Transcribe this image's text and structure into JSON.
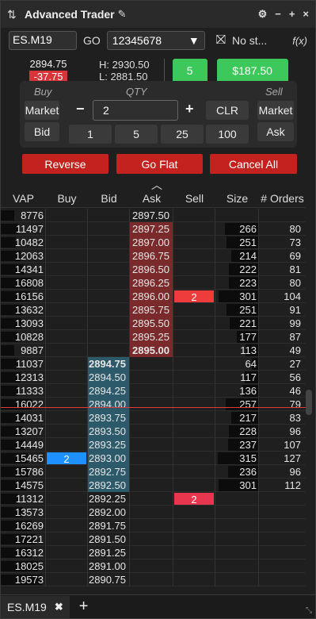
{
  "window": {
    "title": "Advanced Trader",
    "controls": [
      "⚙",
      "−",
      "+",
      "×"
    ]
  },
  "toolbar": {
    "symbol": "ES.M19",
    "go_label": "GO",
    "account": "12345678",
    "strategy": "No st...",
    "fx_label": "f(x)"
  },
  "quote": {
    "last": "2894.75",
    "change": "-37.75",
    "high": "H: 2930.50",
    "low": "L: 2881.50",
    "position": "5",
    "pnl": "$187.50"
  },
  "order_panel": {
    "buy_label": "Buy",
    "qty_label": "QTY",
    "sell_label": "Sell",
    "buy_market": "Market",
    "buy_bid": "Bid",
    "qty_value": "2",
    "minus": "−",
    "plus": "+",
    "clr": "CLR",
    "sell_market": "Market",
    "sell_ask": "Ask",
    "presets": [
      "1",
      "5",
      "25",
      "100"
    ]
  },
  "actions": {
    "reverse": "Reverse",
    "go_flat": "Go Flat",
    "cancel_all": "Cancel All"
  },
  "ladder": {
    "headers": [
      "VAP",
      "Buy",
      "Bid",
      "Ask",
      "Sell",
      "Size",
      "# Orders"
    ],
    "rows": [
      {
        "vap": "8776",
        "bid": "",
        "ask": "2897.50",
        "size": "",
        "orders": "",
        "type": "ask-plain",
        "vapw": 0.3
      },
      {
        "vap": "11497",
        "bid": "",
        "ask": "2897.25",
        "size": "266",
        "orders": "80",
        "type": "ask",
        "vapw": 0.4,
        "sizew": 0.8
      },
      {
        "vap": "10482",
        "bid": "",
        "ask": "2897.00",
        "size": "251",
        "orders": "73",
        "type": "ask",
        "vapw": 0.35,
        "sizew": 0.75
      },
      {
        "vap": "12063",
        "bid": "",
        "ask": "2896.75",
        "size": "214",
        "orders": "69",
        "type": "ask",
        "vapw": 0.45,
        "sizew": 0.65
      },
      {
        "vap": "14341",
        "bid": "",
        "ask": "2896.50",
        "size": "222",
        "orders": "81",
        "type": "ask",
        "vapw": 0.55,
        "sizew": 0.7
      },
      {
        "vap": "16808",
        "bid": "",
        "ask": "2896.25",
        "size": "223",
        "orders": "80",
        "type": "ask",
        "vapw": 0.7,
        "sizew": 0.7
      },
      {
        "vap": "16156",
        "bid": "",
        "ask": "2896.00",
        "size": "301",
        "orders": "104",
        "type": "ask",
        "vapw": 0.68,
        "sizew": 0.95,
        "sell_order": "2"
      },
      {
        "vap": "13632",
        "bid": "",
        "ask": "2895.75",
        "size": "251",
        "orders": "91",
        "type": "ask",
        "vapw": 0.5,
        "sizew": 0.75
      },
      {
        "vap": "13093",
        "bid": "",
        "ask": "2895.50",
        "size": "221",
        "orders": "99",
        "type": "ask",
        "vapw": 0.48,
        "sizew": 0.68
      },
      {
        "vap": "10828",
        "bid": "",
        "ask": "2895.25",
        "size": "177",
        "orders": "87",
        "type": "ask",
        "vapw": 0.38,
        "sizew": 0.5
      },
      {
        "vap": "9887",
        "bid": "",
        "ask": "2895.00",
        "size": "113",
        "orders": "49",
        "type": "ask-bold",
        "vapw": 0.3,
        "sizew": 0.3
      },
      {
        "vap": "11037",
        "bid": "2894.75",
        "ask": "",
        "size": "64",
        "orders": "27",
        "type": "bid-bold",
        "vapw": 0.4,
        "sizew": 0.15
      },
      {
        "vap": "12313",
        "bid": "2894.50",
        "ask": "",
        "size": "117",
        "orders": "56",
        "type": "bid",
        "vapw": 0.45,
        "sizew": 0.32
      },
      {
        "vap": "11333",
        "bid": "2894.25",
        "ask": "",
        "size": "136",
        "orders": "46",
        "type": "bid",
        "vapw": 0.4,
        "sizew": 0.38
      },
      {
        "vap": "16022",
        "bid": "2894.00",
        "ask": "",
        "size": "257",
        "orders": "79",
        "type": "bid",
        "vapw": 0.7,
        "sizew": 0.78
      },
      {
        "vap": "14031",
        "bid": "2893.75",
        "ask": "",
        "size": "217",
        "orders": "83",
        "type": "bid",
        "vapw": 0.55,
        "sizew": 0.65
      },
      {
        "vap": "13207",
        "bid": "2893.50",
        "ask": "",
        "size": "228",
        "orders": "96",
        "type": "bid",
        "vapw": 0.5,
        "sizew": 0.7
      },
      {
        "vap": "14449",
        "bid": "2893.25",
        "ask": "",
        "size": "237",
        "orders": "107",
        "type": "bid",
        "vapw": 0.57,
        "sizew": 0.72
      },
      {
        "vap": "15465",
        "bid": "2893.00",
        "ask": "",
        "size": "315",
        "orders": "127",
        "type": "bid",
        "vapw": 0.62,
        "sizew": 0.97,
        "buy_order": "2"
      },
      {
        "vap": "15786",
        "bid": "2892.75",
        "ask": "",
        "size": "236",
        "orders": "96",
        "type": "bid",
        "vapw": 0.64,
        "sizew": 0.72
      },
      {
        "vap": "14575",
        "bid": "2892.50",
        "ask": "",
        "size": "301",
        "orders": "112",
        "type": "bid",
        "vapw": 0.58,
        "sizew": 0.95
      },
      {
        "vap": "11312",
        "bid": "2892.25",
        "ask": "",
        "size": "",
        "orders": "",
        "type": "plain",
        "vapw": 0.4,
        "sell_order": "2",
        "sell_pink": true
      },
      {
        "vap": "13573",
        "bid": "2892.00",
        "ask": "",
        "size": "",
        "orders": "",
        "type": "plain",
        "vapw": 0.5
      },
      {
        "vap": "16269",
        "bid": "2891.75",
        "ask": "",
        "size": "",
        "orders": "",
        "type": "plain",
        "vapw": 0.7
      },
      {
        "vap": "17221",
        "bid": "2891.50",
        "ask": "",
        "size": "",
        "orders": "",
        "type": "plain",
        "vapw": 0.8
      },
      {
        "vap": "16312",
        "bid": "2891.25",
        "ask": "",
        "size": "",
        "orders": "",
        "type": "plain",
        "vapw": 0.7
      },
      {
        "vap": "18025",
        "bid": "2891.00",
        "ask": "",
        "size": "",
        "orders": "",
        "type": "plain",
        "vapw": 0.85
      },
      {
        "vap": "19573",
        "bid": "2890.75",
        "ask": "",
        "size": "",
        "orders": "",
        "type": "plain",
        "vapw": 0.95
      }
    ],
    "last_line_after_row": 13
  },
  "tabs": [
    {
      "label": "ES.M19"
    }
  ],
  "add_tab": "+",
  "colors": {
    "ask_cell": "#7a2a2a",
    "bid_cell": "#2c5a6a",
    "buy_green": "#3cc85a",
    "action_red": "#c4221e",
    "change_red": "#d8343a",
    "buy_order_blue": "#1e90ff",
    "sell_order_red": "#ee3b3b"
  }
}
